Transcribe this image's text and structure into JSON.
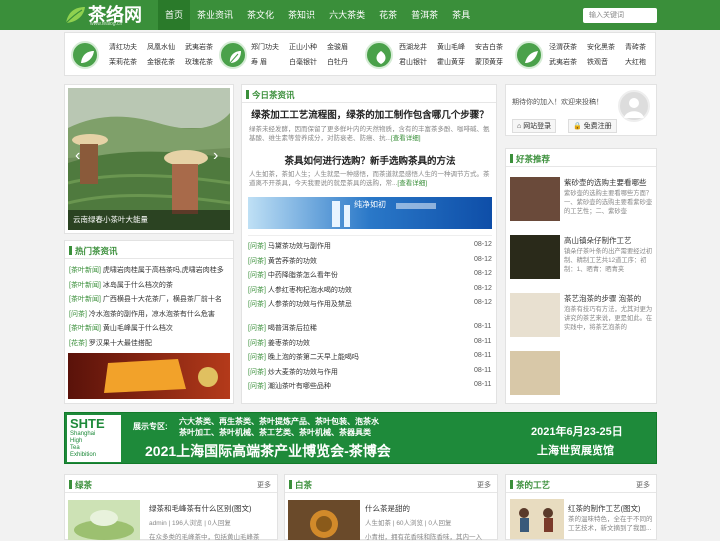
{
  "logo": {
    "text": "茶络网",
    "url": "www.tealog.cn"
  },
  "nav": [
    "首页",
    "茶业资讯",
    "茶文化",
    "茶知识",
    "六大茶类",
    "花茶",
    "普洱茶",
    "茶具"
  ],
  "search": {
    "placeholder": "输入关键词"
  },
  "categories": [
    [
      "清红功夫",
      "凤凰水仙",
      "武夷岩茶",
      "茉莉花茶",
      "金银花茶",
      "玫瑰花茶"
    ],
    [
      "郑门功夫",
      "正山小种",
      "金骏眉",
      "寿 眉",
      "白毫银针",
      "白牡丹"
    ],
    [
      "西湖龙井",
      "黄山毛峰",
      "安吉白茶",
      "君山银针",
      "霍山黄芽",
      "蒙顶黄芽"
    ],
    [
      "泾渭茯茶",
      "安化黑茶",
      "青砖茶",
      "武夷岩茶",
      "铁观音",
      "大红袍"
    ]
  ],
  "carousel": {
    "caption": "云南绿春小茶叶大能量"
  },
  "hot": {
    "title": "热门茶资讯",
    "items": [
      {
        "tag": "[茶叶新闻]",
        "text": "虎啸岩肉桂属于高档茶吗,虎啸岩肉桂多"
      },
      {
        "tag": "[茶叶新闻]",
        "text": "冰岛属于什么档次的茶"
      },
      {
        "tag": "[茶叶新闻]",
        "text": "广西横县十大花茶厂，横县茶厂前十名"
      },
      {
        "tag": "[问茶]",
        "text": "冷水泡茶的副作用，凉水泡茶有什么危害"
      },
      {
        "tag": "[茶叶新闻]",
        "text": "黄山毛峰属于什么档次"
      },
      {
        "tag": "[花茶]",
        "text": "罗汉果十大最佳搭配"
      }
    ]
  },
  "today": {
    "title": "今日茶资讯",
    "a1": {
      "title": "绿茶加工工艺流程图，绿茶的加工制作包含哪几个步骤？",
      "desc": "绿茶未经发酵，因而保留了更多鲜叶内的天然物质，含有的丰富茶多酚、咖啡碱、氨基酸、维生素等营养成分，对防衰老、防癌、抗...",
      "more": "[查看详细]"
    },
    "a2": {
      "title": "茶具如何进行选购？新手选购茶具的方法",
      "desc": "人生如茶，茶如人生；人生就是一种感悟，而茶道就是感悟人生的一种调节方式。茶道离不开茶具，今天我要说的就是茶具的选购，常...",
      "more": "[查看详细]"
    },
    "banner": "纯净如初"
  },
  "news1": [
    {
      "tag": "[问茶]",
      "text": "马黛茶功效与副作用",
      "date": "08-12"
    },
    {
      "tag": "[问茶]",
      "text": "黄苦荞茶的功效",
      "date": "08-12"
    },
    {
      "tag": "[问茶]",
      "text": "中药降脂茶怎么看年份",
      "date": "08-12"
    },
    {
      "tag": "[问茶]",
      "text": "人参红枣枸杞泡水喝的功效",
      "date": "08-12"
    },
    {
      "tag": "[问茶]",
      "text": "人参茶的功效与作用及禁忌",
      "date": "08-12"
    }
  ],
  "news2": [
    {
      "tag": "[问茶]",
      "text": "喝普洱茶后拉稀",
      "date": "08-11"
    },
    {
      "tag": "[问茶]",
      "text": "姜枣茶的功效",
      "date": "08-11"
    },
    {
      "tag": "[问茶]",
      "text": "晚上泡的茶第二天早上能喝吗",
      "date": "08-11"
    },
    {
      "tag": "[问茶]",
      "text": "炒大麦茶的功效与作用",
      "date": "08-11"
    },
    {
      "tag": "[问茶]",
      "text": "潮汕茶叶有哪些品种",
      "date": "08-11"
    }
  ],
  "user": {
    "welcome": "期待你的加入！欢迎来投稿！",
    "login": "网站登录",
    "register": "免费注册"
  },
  "good": {
    "title": "好茶推荐",
    "items": [
      {
        "title": "紫砂壶的选购主要看哪些",
        "desc": "紫砂壶的选购主要看哪些方面？一、紫砂壶的选购主要看紫砂壶的工艺性；二、紫砂壶"
      },
      {
        "title": "高山镇朵仔制作工艺",
        "desc": "镇朵仔茶叶条的出产需要经过初制、精制工艺共12道工序：初制：1、晒青：晒青夹"
      },
      {
        "title": "茶艺泡茶的步骤 泡茶的",
        "desc": "泡茶有技巧有方法，尤其对更为讲究的茶艺来说，更是如此。在实践中，将茶艺泡茶的"
      },
      {
        "title": "",
        "desc": ""
      }
    ]
  },
  "expo": {
    "brand": "SHTE",
    "brand_sub1": "Shanghai",
    "brand_sub2": "High",
    "brand_sub3": "Tea",
    "brand_sub4": "Exhibition",
    "show_label": "展示专区:",
    "row1": "六大茶类、再生茶类、茶叶提炼产品、茶叶包装、泡茶水",
    "row2": "茶叶加工、茶叶机械、茶工艺类、茶叶机械、茶器具类",
    "title": "2021上海国际高端茶产业博览会-茶博会",
    "date": "2021年6月23-25日",
    "venue": "上海世贸展览馆"
  },
  "green": {
    "title": "绿茶",
    "more": "更多",
    "item_title": "绿茶和毛峰茶有什么区别(图文)",
    "author": "admin",
    "views": "196人浏览",
    "replies": "0人回复",
    "desc": "在众多类的毛峰茶中，包括黄山毛峰茶"
  },
  "white": {
    "title": "白茶",
    "more": "更多",
    "item_title": "什么茶是甜的",
    "author": "人生如茶",
    "views": "60人浏览",
    "replies": "0人回复",
    "desc": "小青柑，拥有花香味和陈香味，其内一入"
  },
  "craft": {
    "title": "茶的工艺",
    "more": "更多",
    "item_title": "红茶的制作工艺(图文)",
    "desc": "茶的温味特色，全在于不同的工艺技术，新文摘到了我国..."
  },
  "colors": {
    "green": "#3a8f3a",
    "dark": "#2a7a2a"
  }
}
